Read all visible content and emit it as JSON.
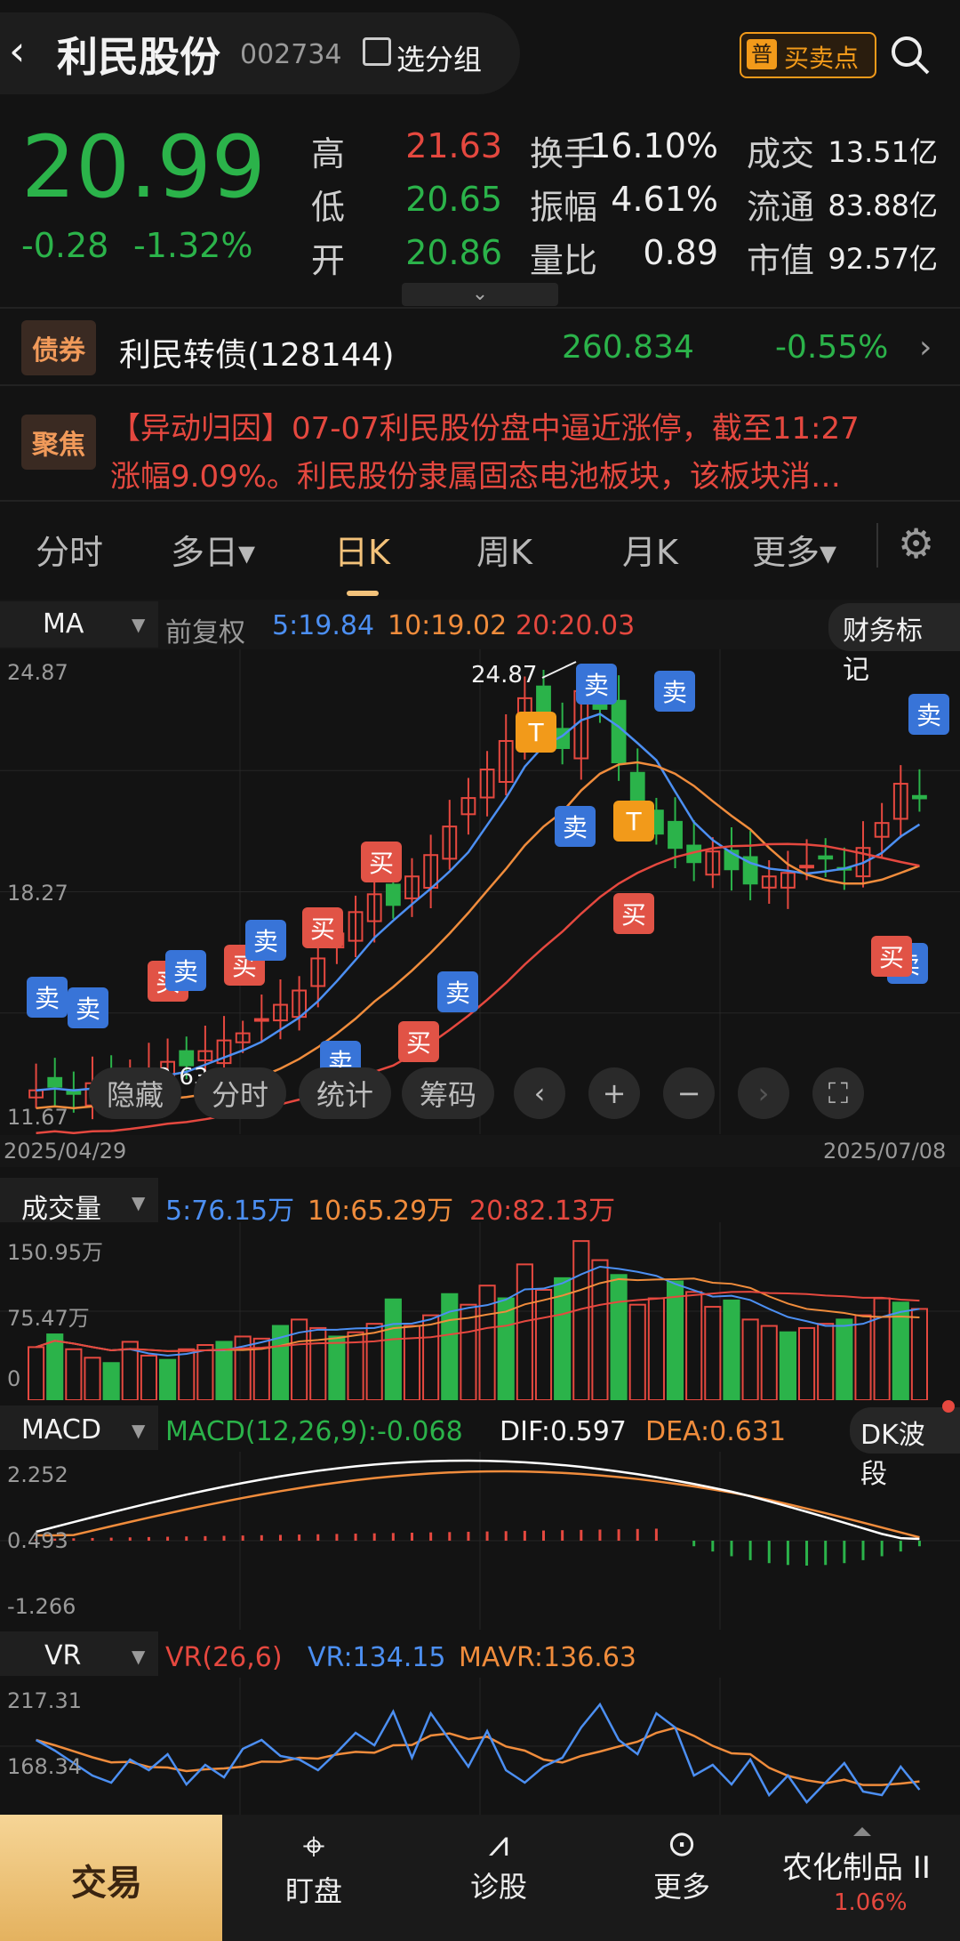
{
  "header": {
    "back_icon": "chevron-left",
    "title": "利民股份",
    "code": "002734",
    "group_label": "选分组",
    "buy_sell_badge": "普",
    "buy_sell_label": "买卖点",
    "search_icon": "search"
  },
  "quote": {
    "price": "20.99",
    "change": "-0.28",
    "change_pct": "-1.32%",
    "stats": [
      [
        {
          "label": "高",
          "value": "21.63",
          "color": "red"
        },
        {
          "label": "换手",
          "value": "16.10%"
        },
        {
          "label": "成交",
          "value": "13.51亿"
        }
      ],
      [
        {
          "label": "低",
          "value": "20.65",
          "color": "green"
        },
        {
          "label": "振幅",
          "value": "4.61%"
        },
        {
          "label": "流通",
          "value": "83.88亿"
        }
      ],
      [
        {
          "label": "开",
          "value": "20.86",
          "color": "green"
        },
        {
          "label": "量比",
          "value": "0.89"
        },
        {
          "label": "市值",
          "value": "92.57亿"
        }
      ]
    ]
  },
  "bond": {
    "tag": "债券",
    "name": "利民转债(128144)",
    "price": "260.834",
    "pct": "-0.55%"
  },
  "news": {
    "tag": "聚焦",
    "line1": "【异动归因】07-07利民股份盘中逼近涨停，截至11:27",
    "line2": "涨幅9.09%。利民股份隶属固态电池板块，该板块消…"
  },
  "tabs": [
    {
      "label": "分时"
    },
    {
      "label": "多日▾"
    },
    {
      "label": "日K"
    },
    {
      "label": "周K"
    },
    {
      "label": "月K"
    },
    {
      "label": "更多▾"
    }
  ],
  "kline": {
    "indicator": "MA",
    "indicator_arrow": "▼",
    "adjust": "前复权",
    "ma5": "5:19.84",
    "ma10": "10:19.02",
    "ma20": "20:20.03",
    "finance": "财务标记",
    "y_max": "24.87",
    "y_mid": "18.27",
    "y_min": "11.67",
    "high_label": "24.87",
    "low_label": "12.63",
    "date_start": "2025/04/29",
    "date_end": "2025/07/08",
    "controls": [
      "隐藏",
      "分时",
      "统计",
      "筹码"
    ],
    "marks": {
      "sell": "卖",
      "buy": "买",
      "t": "T"
    }
  },
  "volume": {
    "label": "成交量",
    "arrow": "▼",
    "ma5": "5:76.15万",
    "ma10": "10:65.29万",
    "ma20": "20:82.13万",
    "y_max": "150.95万",
    "y_mid": "75.47万",
    "y_min": "0"
  },
  "macd": {
    "label": "MACD",
    "arrow": "▼",
    "params": "MACD(12,26,9):-0.068",
    "dif": "DIF:0.597",
    "dea": "DEA:0.631",
    "dk": "DK波段",
    "y_max": "2.252",
    "y_mid": "0.493",
    "y_min": "-1.266"
  },
  "vr": {
    "label": "VR",
    "arrow": "▼",
    "params": "VR(26,6)",
    "vr": "VR:134.15",
    "mavr": "MAVR:136.63",
    "y_max": "217.31",
    "y_mid": "168.34"
  },
  "nav": {
    "trade": "交易",
    "watch": "盯盘",
    "diag": "诊股",
    "more": "更多",
    "sector": "农化制品 II",
    "sector_pct": "1.06%"
  },
  "colors": {
    "up": "#e5483f",
    "down": "#2bb34a",
    "ma5": "#4c8ff2",
    "ma10": "#f08c3c",
    "ma20": "#e5483f"
  }
}
